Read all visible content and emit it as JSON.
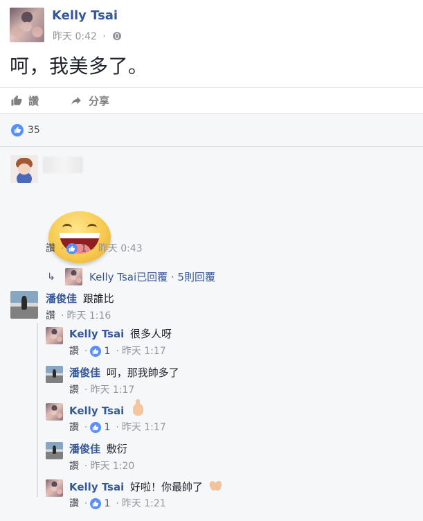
{
  "post": {
    "author": "Kelly Tsai",
    "time": "昨天 0:42",
    "text": "呵，我美多了。",
    "actions": {
      "like": "讚",
      "share": "分享"
    },
    "reaction_count": "35"
  },
  "comments": [
    {
      "author": "",
      "meta": {
        "like": "讚",
        "likes": "1",
        "time": "昨天 0:43"
      },
      "reply_summary": "Kelly Tsai已回覆 · 5則回覆"
    },
    {
      "author": "潘俊佳",
      "text": "跟誰比",
      "meta": {
        "like": "讚",
        "time": "昨天 1:16"
      },
      "replies": [
        {
          "author": "Kelly Tsai",
          "text": "很多人呀",
          "meta": {
            "like": "讚",
            "likes": "1",
            "time": "昨天 1:17"
          }
        },
        {
          "author": "潘俊佳",
          "text": "呵，那我帥多了",
          "meta": {
            "like": "讚",
            "time": "昨天 1:17"
          }
        },
        {
          "author": "Kelly Tsai",
          "text": "",
          "emoji": "thumbs-up-emoji",
          "meta": {
            "like": "讚",
            "likes": "1",
            "time": "昨天 1:17"
          }
        },
        {
          "author": "潘俊佳",
          "text": "敷衍",
          "meta": {
            "like": "讚",
            "time": "昨天 1:20"
          }
        },
        {
          "author": "Kelly Tsai",
          "text": "好啦！你最帥了",
          "emoji": "clapping-hands-emoji",
          "meta": {
            "like": "讚",
            "likes": "1",
            "time": "昨天 1:21"
          }
        }
      ]
    }
  ],
  "colors": {
    "link_blue": "#365899",
    "like_blue": "#5890ff",
    "meta_gray": "#90949c",
    "background": "#f6f7f9"
  },
  "icons": {
    "globe": "globe-icon",
    "like": "thumbs-up-icon",
    "share": "share-arrow-icon",
    "reply": "reply-arrow-icon",
    "smiley": "big-smiley-icon"
  }
}
